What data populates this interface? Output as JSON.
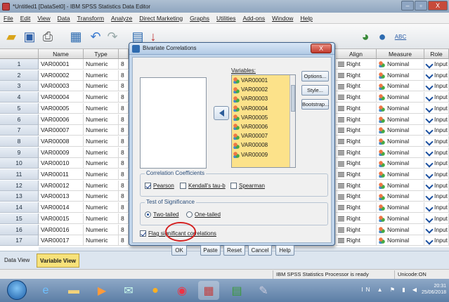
{
  "window": {
    "title": "*Untitled1 [DataSet0] - IBM SPSS Statistics Data Editor",
    "controls": [
      "–",
      "▫",
      "X"
    ]
  },
  "menu": [
    "File",
    "Edit",
    "View",
    "Data",
    "Transform",
    "Analyze",
    "Direct Marketing",
    "Graphs",
    "Utilities",
    "Add-ons",
    "Window",
    "Help"
  ],
  "toolbar": {
    "icons": [
      "open-icon",
      "save-icon",
      "print-icon",
      "dialog-recall-icon",
      "undo-icon",
      "redo-icon",
      "goto-case-icon",
      "goto-variable-icon",
      "variables-icon",
      "find-icon",
      "insert-cases-icon",
      "insert-variable-icon",
      "split-file-icon",
      "weight-cases-icon",
      "select-cases-icon",
      "value-labels-icon",
      "use-sets-icon",
      "spell-check-icon"
    ],
    "abc_label": "ABC"
  },
  "grid": {
    "columns": [
      "Name",
      "Type",
      "",
      "Align",
      "Measure",
      "Role"
    ],
    "rows": [
      {
        "num": "1",
        "name": "VAR00001",
        "type": "Numeric",
        "w": "8",
        "align": "Right",
        "measure": "Nominal",
        "role": "Input"
      },
      {
        "num": "2",
        "name": "VAR00002",
        "type": "Numeric",
        "w": "8",
        "align": "Right",
        "measure": "Nominal",
        "role": "Input"
      },
      {
        "num": "3",
        "name": "VAR00003",
        "type": "Numeric",
        "w": "8",
        "align": "Right",
        "measure": "Nominal",
        "role": "Input"
      },
      {
        "num": "4",
        "name": "VAR00004",
        "type": "Numeric",
        "w": "8",
        "align": "Right",
        "measure": "Nominal",
        "role": "Input"
      },
      {
        "num": "5",
        "name": "VAR00005",
        "type": "Numeric",
        "w": "8",
        "align": "Right",
        "measure": "Nominal",
        "role": "Input"
      },
      {
        "num": "6",
        "name": "VAR00006",
        "type": "Numeric",
        "w": "8",
        "align": "Right",
        "measure": "Nominal",
        "role": "Input"
      },
      {
        "num": "7",
        "name": "VAR00007",
        "type": "Numeric",
        "w": "8",
        "align": "Right",
        "measure": "Nominal",
        "role": "Input"
      },
      {
        "num": "8",
        "name": "VAR00008",
        "type": "Numeric",
        "w": "8",
        "align": "Right",
        "measure": "Nominal",
        "role": "Input"
      },
      {
        "num": "9",
        "name": "VAR00009",
        "type": "Numeric",
        "w": "8",
        "align": "Right",
        "measure": "Nominal",
        "role": "Input"
      },
      {
        "num": "10",
        "name": "VAR00010",
        "type": "Numeric",
        "w": "8",
        "align": "Right",
        "measure": "Nominal",
        "role": "Input"
      },
      {
        "num": "11",
        "name": "VAR00011",
        "type": "Numeric",
        "w": "8",
        "align": "Right",
        "measure": "Nominal",
        "role": "Input"
      },
      {
        "num": "12",
        "name": "VAR00012",
        "type": "Numeric",
        "w": "8",
        "align": "Right",
        "measure": "Nominal",
        "role": "Input"
      },
      {
        "num": "13",
        "name": "VAR00013",
        "type": "Numeric",
        "w": "8",
        "align": "Right",
        "measure": "Nominal",
        "role": "Input"
      },
      {
        "num": "14",
        "name": "VAR00014",
        "type": "Numeric",
        "w": "8",
        "align": "Right",
        "measure": "Nominal",
        "role": "Input"
      },
      {
        "num": "15",
        "name": "VAR00015",
        "type": "Numeric",
        "w": "8",
        "align": "Right",
        "measure": "Nominal",
        "role": "Input"
      },
      {
        "num": "16",
        "name": "VAR00016",
        "type": "Numeric",
        "w": "8",
        "align": "Right",
        "measure": "Nominal",
        "role": "Input"
      },
      {
        "num": "17",
        "name": "VAR00017",
        "type": "Numeric",
        "w": "8",
        "align": "Right",
        "measure": "Nominal",
        "role": "Input"
      }
    ]
  },
  "tabs": [
    {
      "label": "Data View",
      "active": false
    },
    {
      "label": "Variable View",
      "active": true
    }
  ],
  "status": {
    "processor": "IBM SPSS Statistics Processor is ready",
    "unicode": "Unicode:ON"
  },
  "clock": {
    "time": "20:31",
    "date": "25/06/2018"
  },
  "tray_text": "IN",
  "dialog": {
    "title": "Bivariate Correlations",
    "close": "X",
    "variables_label": "Variables:",
    "variables": [
      "VAR00001",
      "VAR00002",
      "VAR00003",
      "VAR00004",
      "VAR00005",
      "VAR00006",
      "VAR00007",
      "VAR00008",
      "VAR00009"
    ],
    "side_buttons": [
      "Options...",
      "Style...",
      "Bootstrap..."
    ],
    "coef_group": {
      "title": "Correlation Coefficients",
      "pearson": {
        "label": "Pearson",
        "checked": true
      },
      "kendall": {
        "label": "Kendall's tau-b",
        "checked": false
      },
      "spearman": {
        "label": "Spearman",
        "checked": false
      }
    },
    "sig_group": {
      "title": "Test of Significance",
      "two_tailed": {
        "label": "Two-tailed",
        "selected": true
      },
      "one_tailed": {
        "label": "One-tailed",
        "selected": false
      }
    },
    "flag": {
      "label": "Flag significant correlations",
      "checked": true
    },
    "buttons": [
      "OK",
      "Paste",
      "Reset",
      "Cancel",
      "Help"
    ]
  },
  "colors": {
    "highlight_circle": "#d42020",
    "variable_list_bg": "#fce28a"
  }
}
